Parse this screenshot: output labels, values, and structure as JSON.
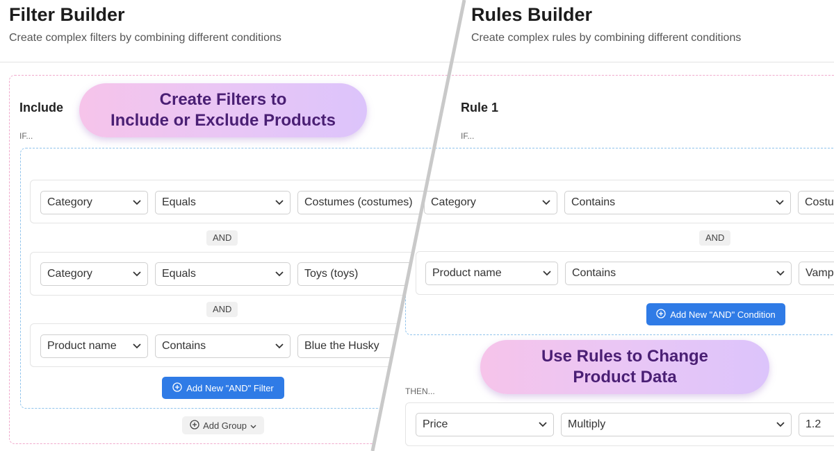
{
  "left": {
    "title": "Filter Builder",
    "subtitle": "Create complex filters by combining different conditions",
    "section_title": "Include",
    "if_label": "IF...",
    "bubble_line1": "Create Filters to",
    "bubble_line2": "Include or Exclude Products",
    "rows": [
      {
        "field": "Category",
        "op": "Equals",
        "value": "Costumes (costumes)"
      },
      {
        "field": "Category",
        "op": "Equals",
        "value": "Toys (toys)"
      },
      {
        "field": "Product name",
        "op": "Contains",
        "value": "Blue the Husky"
      }
    ],
    "and_label": "AND",
    "add_filter_label": "Add New \"AND\" Filter",
    "add_group_label": "Add Group"
  },
  "right": {
    "title": "Rules Builder",
    "subtitle": "Create complex rules by combining different conditions",
    "section_title": "Rule 1",
    "if_label": "IF...",
    "rows": [
      {
        "field": "Category",
        "op": "Contains",
        "value": "Costur"
      },
      {
        "field": "Product name",
        "op": "Contains",
        "value": "Vampi"
      }
    ],
    "and_label": "AND",
    "add_condition_label": "Add New \"AND\" Condition",
    "bubble_line1": "Use Rules to Change",
    "bubble_line2": "Product Data",
    "then_label": "THEN...",
    "action": {
      "field": "Price",
      "op": "Multiply",
      "value": "1.2"
    }
  }
}
